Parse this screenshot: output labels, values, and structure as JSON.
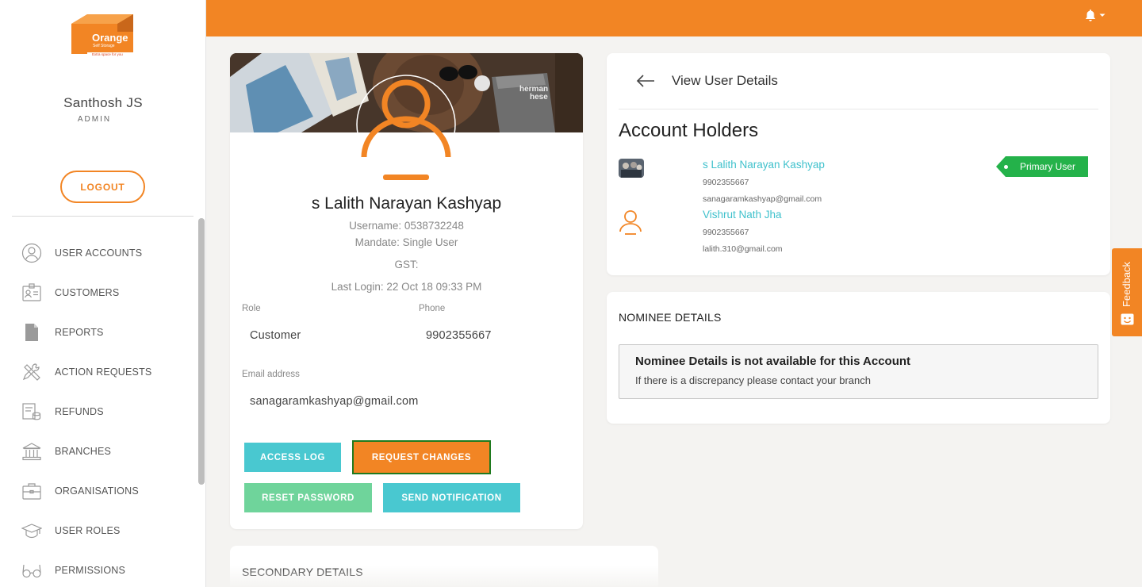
{
  "brand": {
    "logo_text": "Orange",
    "logo_sub": "Self Storage",
    "logo_tagline": "Extra space for you",
    "accent_color": "#f28524",
    "teal_color": "#3fc1cc",
    "green_color": "#24b24a"
  },
  "sidebar": {
    "user_name": "Santhosh JS",
    "user_role": "ADMIN",
    "logout_label": "LOGOUT",
    "items": [
      {
        "label": "USER ACCOUNTS",
        "icon": "user-circle-icon"
      },
      {
        "label": "CUSTOMERS",
        "icon": "id-card-icon"
      },
      {
        "label": "REPORTS",
        "icon": "document-icon"
      },
      {
        "label": "ACTION REQUESTS",
        "icon": "tools-icon"
      },
      {
        "label": "REFUNDS",
        "icon": "refund-icon"
      },
      {
        "label": "BRANCHES",
        "icon": "bank-icon"
      },
      {
        "label": "ORGANISATIONS",
        "icon": "briefcase-icon"
      },
      {
        "label": "USER ROLES",
        "icon": "graduation-cap-icon"
      },
      {
        "label": "PERMISSIONS",
        "icon": "glasses-icon"
      }
    ]
  },
  "topbar": {
    "notification_icon": "bell-icon"
  },
  "profile": {
    "name": "s Lalith Narayan Kashyap",
    "username": "Username: 0538732248",
    "mandate": "Mandate: Single User",
    "gst": "GST:",
    "last_login": "Last Login: 22 Oct 18 09:33 PM",
    "role_label": "Role",
    "role_value": "Customer",
    "phone_label": "Phone",
    "phone_value": "9902355667",
    "email_label": "Email address",
    "email_value": "sanagaramkashyap@gmail.com",
    "buttons": {
      "access_log": "ACCESS LOG",
      "request_changes": "REQUEST CHANGES",
      "reset_password": "RESET PASSWORD",
      "send_notification": "SEND NOTIFICATION"
    }
  },
  "details": {
    "title": "View User Details",
    "section_title": "Account Holders",
    "holders": [
      {
        "name": "s Lalith Narayan Kashyap",
        "phone": "9902355667",
        "email": "sanagaramkashyap@gmail.com",
        "badge": "Primary User"
      },
      {
        "name": "Vishrut Nath Jha",
        "phone": "9902355667",
        "email": "lalith.310@gmail.com"
      }
    ]
  },
  "nominee": {
    "heading": "NOMINEE DETAILS",
    "box_title": "Nominee Details is not available for this Account",
    "box_text": "If there is a discrepancy please contact your branch"
  },
  "secondary": {
    "heading": "SECONDARY DETAILS"
  },
  "feedback": {
    "label": "Feedback"
  }
}
